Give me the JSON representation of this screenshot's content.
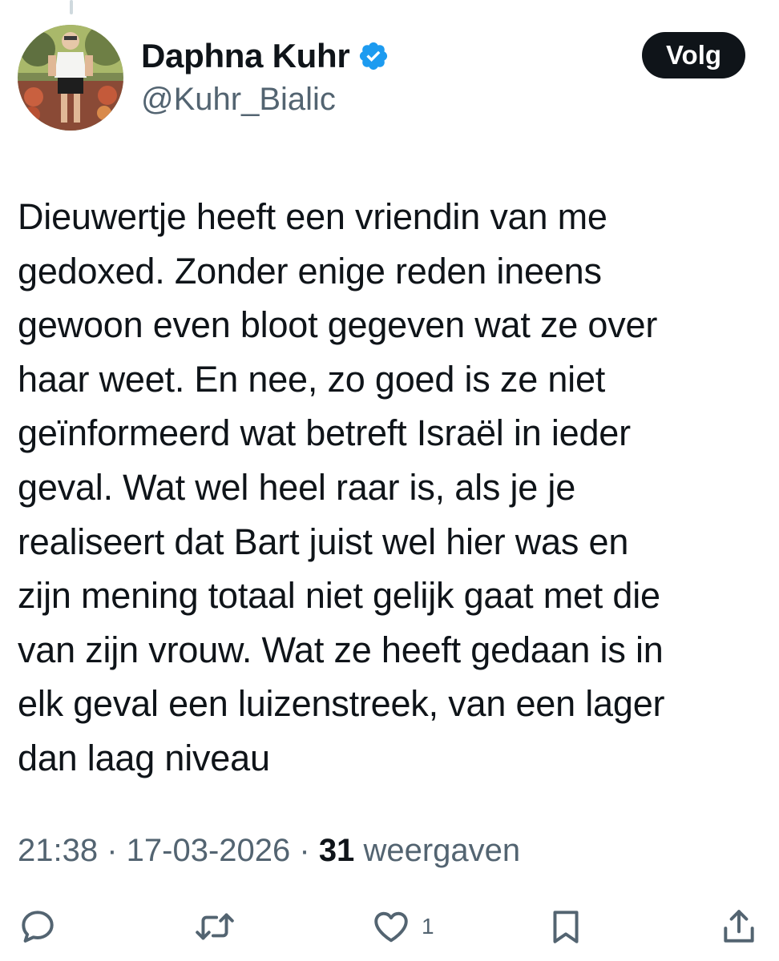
{
  "user": {
    "display_name": "Daphna Kuhr",
    "handle": "@Kuhr_Bialic",
    "verified_icon": "verified-badge-icon",
    "verified_color": "#1d9bf0",
    "avatar_icon": "profile-photo"
  },
  "follow_button": {
    "label": "Volg"
  },
  "tweet": {
    "lines": [
      "Dieuwertje heeft een vriendin van me",
      "gedoxed. Zonder enige reden ineens",
      "gewoon even bloot gegeven wat ze over",
      "haar weet. En nee, zo goed is ze niet",
      "geïnformeerd wat betreft Israël in ieder",
      "geval. Wat wel heel raar is, als je je",
      "realiseert dat Bart juist wel hier was en",
      "zijn mening totaal niet gelijk gaat met die",
      "van zijn vrouw. Wat ze heeft gedaan is in",
      "elk geval een luizenstreek, van een lager",
      "dan laag niveau"
    ]
  },
  "meta": {
    "time": "21:38",
    "separator": " · ",
    "date": "17-03-2026",
    "views_count": "31",
    "views_label": "weergaven"
  },
  "actions": {
    "reply_icon": "reply-icon",
    "retweet_icon": "retweet-icon",
    "like_icon": "heart-icon",
    "like_count": "1",
    "bookmark_icon": "bookmark-icon",
    "share_icon": "share-icon"
  },
  "colors": {
    "text_primary": "#0f1419",
    "text_secondary": "#536471",
    "accent": "#1d9bf0",
    "button_bg": "#0f1419"
  }
}
